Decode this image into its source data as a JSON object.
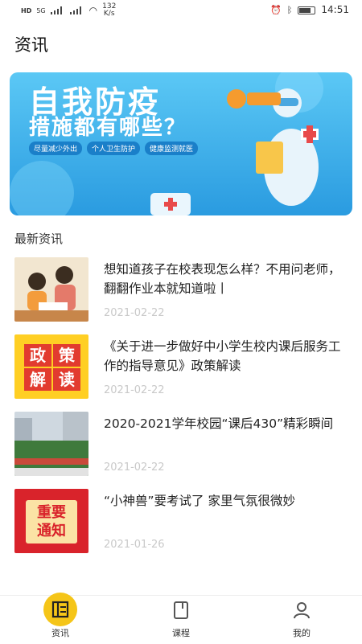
{
  "status_bar": {
    "speed": "132",
    "speed_unit": "K/s",
    "time": "14:51",
    "hd1": "HD",
    "hd2": "HD",
    "net": "5G"
  },
  "page_title": "资讯",
  "banner": {
    "heading": "自我防疫",
    "subheading": "措施都有哪些？",
    "tags": [
      "尽量减少外出",
      "个人卫生防护",
      "健康监测就医"
    ]
  },
  "section_title": "最新资讯",
  "news": [
    {
      "title": "想知道孩子在校表现怎么样？不用问老师，翻翻作业本就知道啦丨",
      "date": "2021-02-22"
    },
    {
      "title": "《关于进一步做好中小学生校内课后服务工作的指导意见》政策解读",
      "date": "2021-02-22",
      "thumb_text": [
        "政",
        "策",
        "解",
        "读"
      ]
    },
    {
      "title": "2020-2021学年校园“课后430”精彩瞬间",
      "date": "2021-02-22"
    },
    {
      "title": "“小神兽”要考试了 家里气氛很微妙",
      "date": "2021-01-26",
      "thumb_text": [
        "重要",
        "通知"
      ]
    }
  ],
  "tabs": [
    {
      "label": "资讯"
    },
    {
      "label": "课程"
    },
    {
      "label": "我的"
    }
  ],
  "colors": {
    "accent": "#f5c518",
    "date": "#c9c9c9"
  }
}
